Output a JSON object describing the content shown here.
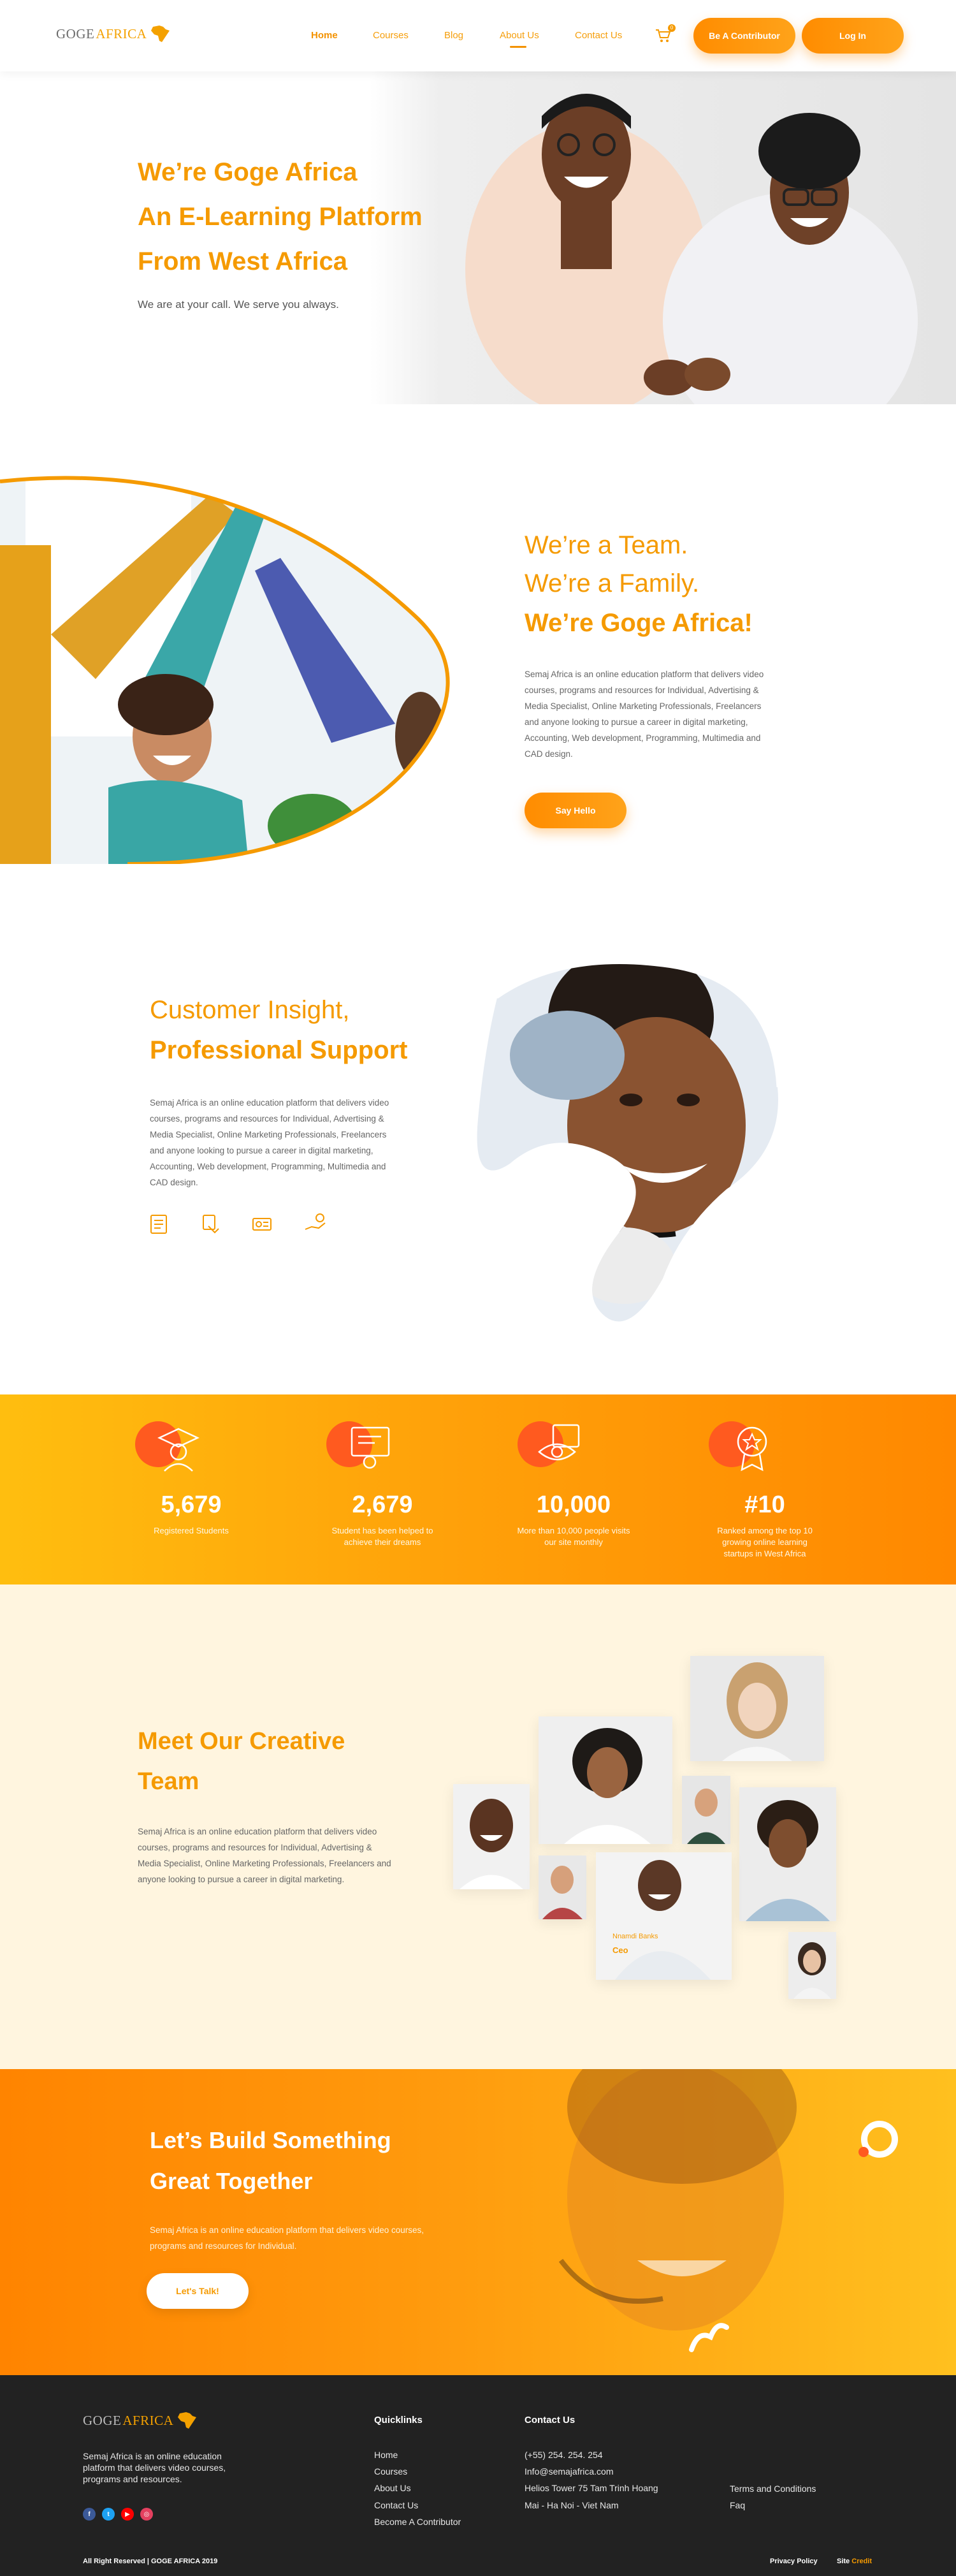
{
  "nav": {
    "logo_goge": "GOGE",
    "logo_africa": "AFRICA",
    "links": [
      "Home",
      "Courses",
      "Blog",
      "About Us",
      "Contact Us"
    ],
    "cart_count": "0",
    "contributor_btn": "Be A Contributor",
    "login_btn": "Log In"
  },
  "hero": {
    "line1": "We’re Goge Africa",
    "line2": "An E-Learning Platform",
    "line3": "From West Africa",
    "sub": "We are at your call. We serve you always."
  },
  "team": {
    "line1": "We’re a Team.",
    "line2": "We’re a Family.",
    "line3": "We’re Goge Africa!",
    "para": "Semaj Africa is an online education platform that delivers video courses, programs and resources for Individual, Advertising & Media Specialist, Online Marketing Professionals, Freelancers and anyone looking to pursue a career in digital marketing, Accounting, Web development, Programming, Multimedia and CAD design.",
    "btn": "Say Hello"
  },
  "insight": {
    "line1": "Customer Insight,",
    "line2": "Professional Support",
    "para": "Semaj Africa is an online education platform that delivers video courses, programs and resources for Individual, Advertising & Media Specialist, Online Marketing Professionals, Freelancers and anyone looking to pursue a career in digital marketing, Accounting, Web development, Programming, Multimedia and CAD design."
  },
  "stats": [
    {
      "num": "5,679",
      "label": "Registered Students",
      "icon": "graduate-icon"
    },
    {
      "num": "2,679",
      "label": "Student has been helped to achieve their dreams",
      "icon": "certificate-icon"
    },
    {
      "num": "10,000",
      "label": "More than 10,000 people visits our site monthly",
      "icon": "view-icon"
    },
    {
      "num": "#10",
      "label": "Ranked among the top 10 growing online learning startups in West Africa",
      "icon": "award-icon"
    }
  ],
  "meet": {
    "line1": "Meet Our Creative",
    "line2": "Team",
    "para": "Semaj Africa is an online education platform that delivers video courses, programs and resources for Individual, Advertising & Media Specialist, Online Marketing Professionals, Freelancers and anyone looking to pursue a career in digital marketing.",
    "featured_name": "Nnamdi Banks",
    "featured_role": "Ceo"
  },
  "cta": {
    "line1": "Let’s Build Something",
    "line2": "Great Together",
    "para": "Semaj Africa is an online education platform that delivers video courses, programs and resources for Individual.",
    "btn": "Let's Talk!"
  },
  "footer": {
    "desc": "Semaj Africa is an online education platform that delivers video courses, programs and resources.",
    "quicklinks_title": "Quicklinks",
    "quicklinks": [
      "Home",
      "Courses",
      "About Us",
      "Contact Us",
      "Become A Contributor"
    ],
    "contact_title": "Contact Us",
    "phone": "(+55) 254. 254. 254",
    "email": "Info@semajafrica.com",
    "address1": "Helios Tower 75 Tam Trinh Hoang",
    "address2": "Mai - Ha Noi - Viet Nam",
    "terms": "Terms and Conditions",
    "faq": "Faq",
    "copyright": "All Right Reserved | GOGE AFRICA 2019",
    "privacy": "Privacy Policy",
    "site": "Site",
    "credit": "Credit"
  },
  "colors": {
    "accent": "#f59a00",
    "orange": "#ff8c00",
    "footer_bg": "#222222",
    "cream": "#fff5df"
  }
}
